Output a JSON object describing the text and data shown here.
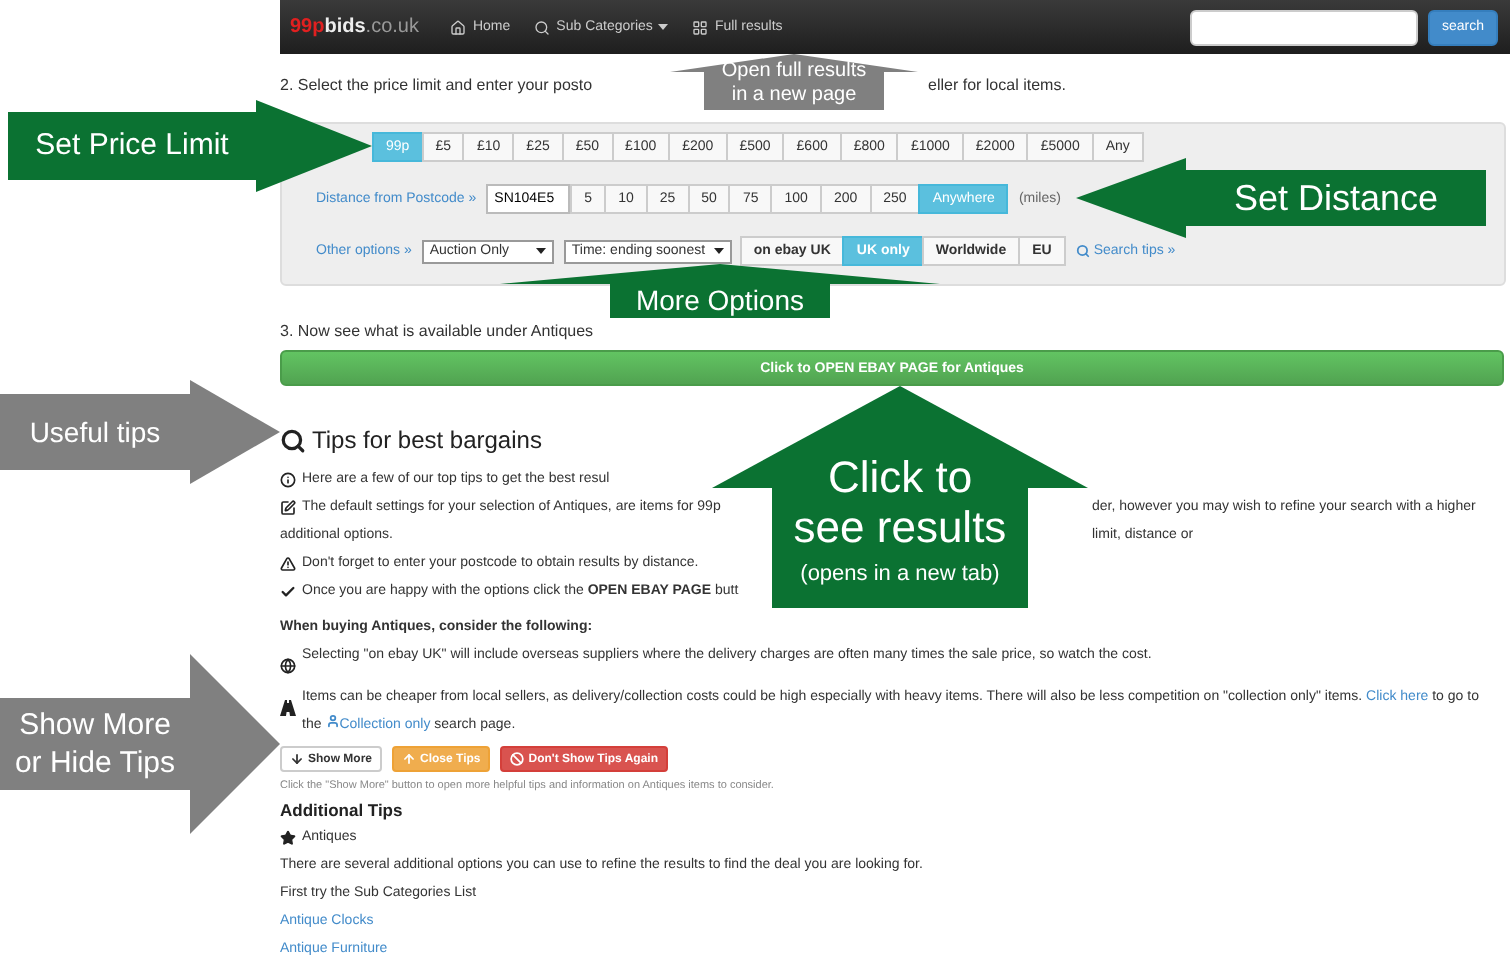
{
  "navbar": {
    "logo": {
      "accent": "99p",
      "name": "bids",
      "domain": ".co.uk"
    },
    "links": [
      {
        "kind": "home",
        "label": "Home",
        "dropdown": false
      },
      {
        "kind": "search",
        "label": "Sub Categories",
        "dropdown": true
      },
      {
        "kind": "grid",
        "label": "Full results",
        "dropdown": false
      }
    ],
    "search": {
      "button": "search"
    }
  },
  "step2": {
    "before": "2. Select the price limit and enter your posto",
    "after": "eller for local items."
  },
  "filters": {
    "prices": [
      {
        "label": "99p",
        "selected": true
      },
      {
        "label": "£5",
        "selected": false
      },
      {
        "label": "£10",
        "selected": false
      },
      {
        "label": "£25",
        "selected": false
      },
      {
        "label": "£50",
        "selected": false
      },
      {
        "label": "£100",
        "selected": false
      },
      {
        "label": "£200",
        "selected": false
      },
      {
        "label": "£500",
        "selected": false
      },
      {
        "label": "£600",
        "selected": false
      },
      {
        "label": "£800",
        "selected": false
      },
      {
        "label": "£1000",
        "selected": false
      },
      {
        "label": "£2000",
        "selected": false
      },
      {
        "label": "£5000",
        "selected": false
      },
      {
        "label": "Any",
        "selected": false
      }
    ],
    "distance": {
      "label": "Distance from Postcode »",
      "postcode": "SN104E5",
      "options": [
        {
          "label": "5",
          "selected": false
        },
        {
          "label": "10",
          "selected": false
        },
        {
          "label": "25",
          "selected": false
        },
        {
          "label": "50",
          "selected": false
        },
        {
          "label": "75",
          "selected": false
        },
        {
          "label": "100",
          "selected": false
        },
        {
          "label": "200",
          "selected": false
        },
        {
          "label": "250",
          "selected": false
        },
        {
          "label": "Anywhere",
          "selected": true
        }
      ],
      "unit": "(miles)"
    },
    "other": {
      "label": "Other options »",
      "selects": [
        "Auction Only",
        "Time: ending soonest"
      ],
      "scopes": [
        {
          "label": "on ebay UK",
          "selected": false
        },
        {
          "label": "UK only",
          "selected": true
        },
        {
          "label": "Worldwide",
          "selected": false
        },
        {
          "label": "EU",
          "selected": false
        }
      ],
      "tips_link": "Search tips »"
    }
  },
  "step3": "3. Now see what is available under Antiques",
  "open_button": "Click to OPEN EBAY PAGE for Antiques",
  "tips": {
    "title": "Tips for best bargains",
    "items": [
      {
        "kind": "info",
        "text": "Here are a few of our top tips to get the best resul"
      },
      {
        "kind": "edit",
        "text": "The default settings for your selection of Antiques, are items for 99p",
        "text_after_callout": "der, however you may wish to refine your search with a higher limit, distance or",
        "next_line": "additional options."
      },
      {
        "kind": "warning",
        "text": "Don't forget to enter your postcode to obtain results by distance."
      },
      {
        "kind": "check",
        "text": "Once you are happy with the options click the **OPEN EBAY PAGE** butt"
      }
    ],
    "subheading": "When buying Antiques, consider the following:",
    "considerations": [
      {
        "kind": "globe",
        "text": "Selecting \"on ebay UK\" will include overseas suppliers where the delivery charges are often many times the sale price, so watch the cost."
      },
      {
        "kind": "road",
        "text": "Items can be cheaper from local sellers, as delivery/collection costs could be high especially with heavy items. There will also be less competition on \"collection only\" items.",
        "link": "Click here",
        "middle": "to go to the",
        "link2": "Collection only",
        "end": "search page."
      }
    ],
    "buttons": [
      {
        "kind": "more",
        "label": "Show More"
      },
      {
        "kind": "close",
        "label": "Close Tips"
      },
      {
        "kind": "never",
        "label": "Don't Show Tips Again"
      }
    ],
    "note": "Click the \"Show More\" button to open more helpful tips and information on Antiques items to consider."
  },
  "additional": {
    "title": "Additional Tips",
    "category": "Antiques",
    "text": "There are several additional options you can use to refine the results to find the deal you are looking for.",
    "prompt": "First try the Sub Categories List",
    "links": [
      "Antique Clocks",
      "Antique Furniture"
    ]
  },
  "callouts": [
    {
      "kind": "up",
      "color": "#808080",
      "lines": [
        "Open full results",
        "in a new page"
      ]
    },
    {
      "kind": "right",
      "color": "#0b7232",
      "lines": [
        "Set Price Limit"
      ]
    },
    {
      "kind": "left",
      "color": "#0b7232",
      "lines": [
        "Set Distance"
      ]
    },
    {
      "kind": "up",
      "color": "#0b7232",
      "lines": [
        "More Options"
      ]
    },
    {
      "kind": "right",
      "color": "#808080",
      "lines": [
        "Useful tips"
      ]
    },
    {
      "kind": "up",
      "color": "#0b7232",
      "lines": [
        "Click to",
        "see results",
        "(opens in a new tab)"
      ]
    },
    {
      "kind": "right",
      "color": "#808080",
      "lines": [
        "Show More",
        "or Hide Tips"
      ]
    }
  ]
}
